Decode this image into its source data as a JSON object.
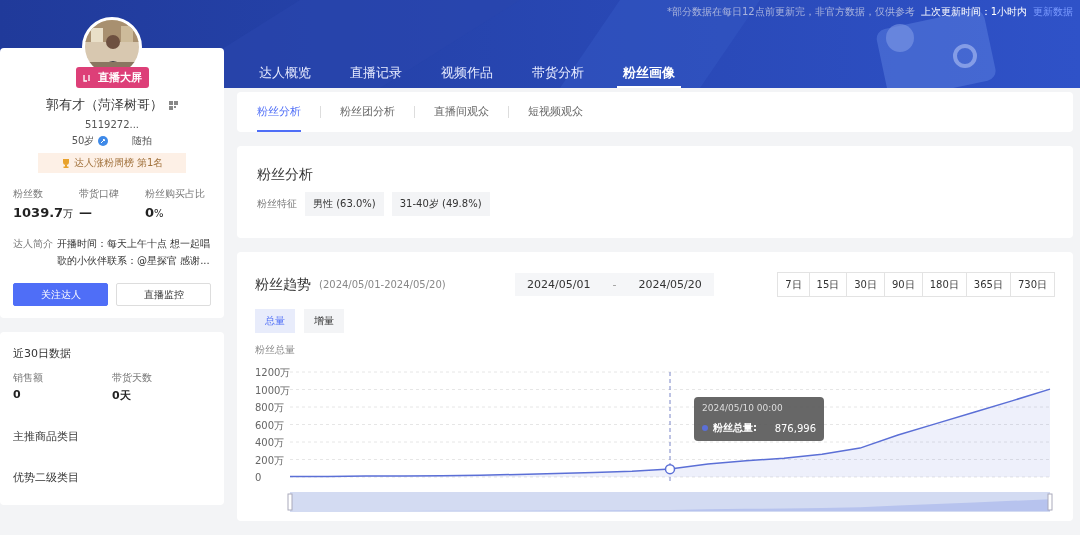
{
  "header": {
    "notice": "*部分数据在每日12点前更新完，非官方数据，仅供参考",
    "update_label": "上次更新时间：1小时内",
    "update_link": "更新数据"
  },
  "profile": {
    "live_badge": "直播大屏",
    "name": "郭有才（菏泽树哥）",
    "id": "5119272...",
    "age": "50岁",
    "category": "随拍",
    "rank": "达人涨粉周榜 第1名",
    "stats": [
      {
        "label": "粉丝数",
        "value": "1039.7",
        "unit": "万"
      },
      {
        "label": "带货口碑",
        "value": "—"
      },
      {
        "label": "粉丝购买占比",
        "value": "0",
        "unit": "%"
      }
    ],
    "intro_label": "达人简介",
    "intro": "开播时间：每天上午十点 想一起唱歌的小伙伴联系：@星探官 感谢...",
    "buttons": [
      {
        "label": "关注达人",
        "kind": "primary"
      },
      {
        "label": "直播监控",
        "kind": "default"
      }
    ]
  },
  "recent": {
    "title": "近30日数据",
    "stats": [
      {
        "label": "销售额",
        "value": "0"
      },
      {
        "label": "带货天数",
        "value": "0天"
      }
    ],
    "sections": [
      "主推商品类目",
      "优势二级类目"
    ]
  },
  "tabs": [
    {
      "label": "达人概览",
      "selected": false
    },
    {
      "label": "直播记录",
      "selected": false
    },
    {
      "label": "视频作品",
      "selected": false
    },
    {
      "label": "带货分析",
      "selected": false
    },
    {
      "label": "粉丝画像",
      "selected": true
    }
  ],
  "subtabs": [
    {
      "label": "粉丝分析",
      "selected": true
    },
    {
      "label": "粉丝团分析",
      "selected": false
    },
    {
      "label": "直播间观众",
      "selected": false
    },
    {
      "label": "短视频观众",
      "selected": false
    }
  ],
  "fan_analysis": {
    "title": "粉丝分析",
    "feature_label": "粉丝特征",
    "tags": [
      "男性 (63.0%)",
      "31-40岁 (49.8%)"
    ]
  },
  "trend": {
    "title": "粉丝趋势",
    "range_note": "(2024/05/01-2024/05/20)",
    "start_date": "2024/05/01",
    "separator": "-",
    "end_date": "2024/05/20",
    "periods": [
      {
        "label": "7日",
        "selected": false
      },
      {
        "label": "15日",
        "selected": false
      },
      {
        "label": "30日",
        "selected": false
      },
      {
        "label": "90日",
        "selected": false
      },
      {
        "label": "180日",
        "selected": false
      },
      {
        "label": "365日",
        "selected": false
      },
      {
        "label": "730日",
        "selected": false
      }
    ],
    "modes": [
      {
        "label": "总量",
        "selected": true
      },
      {
        "label": "增量",
        "selected": false
      }
    ],
    "tooltip": {
      "time": "2024/05/10 00:00",
      "label": "粉丝总量:",
      "value": "876,996"
    },
    "chart_data": {
      "type": "area",
      "ylabel": "粉丝总量",
      "ylim": [
        0,
        1200
      ],
      "grid": true,
      "yticks": [
        {
          "value": 0,
          "label": "0"
        },
        {
          "value": 200,
          "label": "200万"
        },
        {
          "value": 400,
          "label": "400万"
        },
        {
          "value": 600,
          "label": "600万"
        },
        {
          "value": 800,
          "label": "800万"
        },
        {
          "value": 1000,
          "label": "1000万"
        },
        {
          "value": 1200,
          "label": "1200万"
        }
      ],
      "series": [
        {
          "color": "#5b6fd6",
          "values": [
            5,
            5,
            10,
            10,
            15,
            20,
            30,
            40,
            50,
            65,
            90,
            150,
            185,
            215,
            260,
            330,
            480,
            610,
            740,
            870,
            1005
          ]
        }
      ]
    }
  }
}
